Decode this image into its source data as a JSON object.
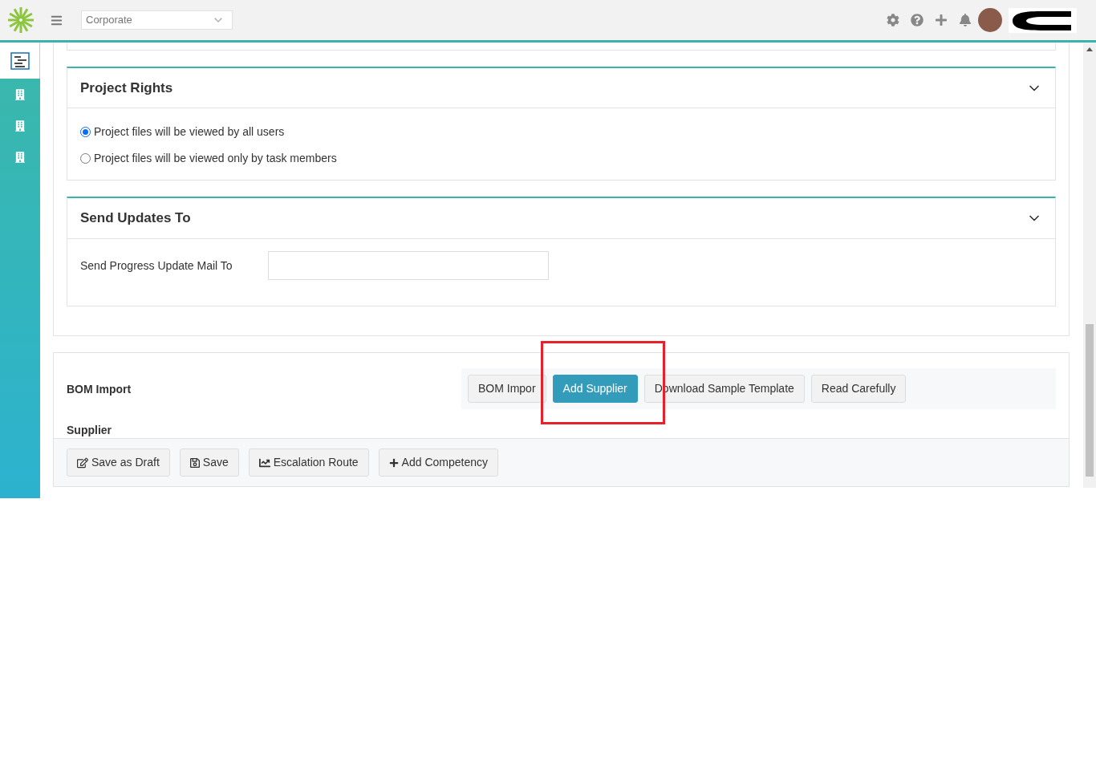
{
  "topbar": {
    "org_select": {
      "value": "Corporate"
    }
  },
  "sidebar": {
    "items": [
      {
        "kind": "tasks",
        "selected": true
      },
      {
        "kind": "building",
        "selected": false
      },
      {
        "kind": "building",
        "selected": false
      },
      {
        "kind": "building",
        "selected": false
      }
    ]
  },
  "project_rights": {
    "title": "Project Rights",
    "expanded": true,
    "options": [
      {
        "label": "Project files will be viewed by all users",
        "selected": true
      },
      {
        "label": "Project files will be viewed only by task members",
        "selected": false
      }
    ]
  },
  "send_updates": {
    "title": "Send Updates To",
    "expanded": true,
    "label": "Send Progress Update Mail To"
  },
  "bom": {
    "label": "BOM Import",
    "buttons": [
      {
        "label": "BOM Impor",
        "kind": "default"
      },
      {
        "label": "Add Supplier",
        "kind": "primary"
      },
      {
        "label": "Download Sample Template",
        "kind": "default"
      },
      {
        "label": "Read Carefully",
        "kind": "default"
      }
    ],
    "supplier_label": "Supplier"
  },
  "footer_buttons": [
    {
      "label": "Save as Draft",
      "kind": "draft"
    },
    {
      "label": "Save",
      "kind": "save"
    },
    {
      "label": "Escalation Route",
      "kind": "chart"
    },
    {
      "label": "Add Competency",
      "kind": "plus"
    }
  ]
}
